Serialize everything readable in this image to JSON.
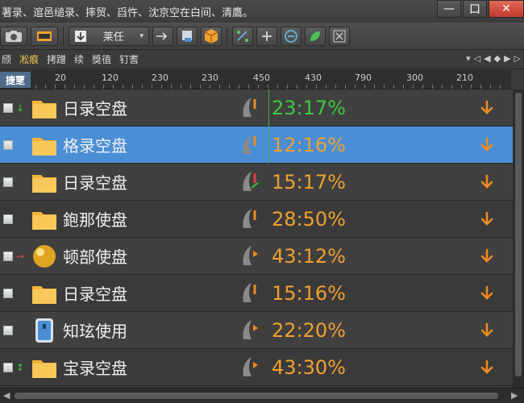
{
  "window": {
    "title": "著录、逭邑缒录、摔贸、舀忤、沈京空在白间、清鷹。",
    "minimize": "—",
    "maximize": "口",
    "close": "✕"
  },
  "toolbar": {
    "combo_label": "莱任",
    "icons": [
      "camera-icon",
      "film-icon",
      "down-arrow-icon",
      "arrow-right-icon",
      "export-icon",
      "cube-icon",
      "link-icon",
      "link-icon",
      "filter-icon",
      "leaf-icon",
      "close-box-icon"
    ]
  },
  "menubar": {
    "items": [
      "颀",
      "凇痕",
      "拷蹭",
      "续",
      "獎徝",
      "钉耆"
    ],
    "active_index": 1
  },
  "ruler": {
    "head_label": "捷覂",
    "ticks": [
      "20",
      "120",
      "230",
      "230",
      "450",
      "430",
      "790",
      "300",
      "210"
    ]
  },
  "rows": [
    {
      "name": "日录空盘",
      "value": "23:17%",
      "icon": "folder",
      "marker": "↓",
      "marker_color": "#3ec93e",
      "value_color": "green"
    },
    {
      "name": "格录空盘",
      "value": "12:16%",
      "icon": "folder",
      "marker": "",
      "marker_color": "",
      "value_color": "orange"
    },
    {
      "name": "日录空盘",
      "value": "15:17%",
      "icon": "folder",
      "marker": "",
      "marker_color": "",
      "value_color": "orange"
    },
    {
      "name": "鉋那使盘",
      "value": "28:50%",
      "icon": "folder",
      "marker": "",
      "marker_color": "",
      "value_color": "orange"
    },
    {
      "name": "顿部使盘",
      "value": "43:12%",
      "icon": "sphere",
      "marker": "→",
      "marker_color": "#e04040",
      "value_color": "orange"
    },
    {
      "name": "日录空盘",
      "value": "15:16%",
      "icon": "folder",
      "marker": "",
      "marker_color": "",
      "value_color": "orange"
    },
    {
      "name": "知玹使用",
      "value": "22:20%",
      "icon": "phone",
      "marker": "",
      "marker_color": "",
      "value_color": "orange"
    },
    {
      "name": "宝录空盘",
      "value": "43:30%",
      "icon": "folder",
      "marker": "↕",
      "marker_color": "#3ec93e",
      "value_color": "orange"
    }
  ],
  "selected_row": 1,
  "colors": {
    "selection": "#4a8fd6",
    "value_orange": "#f0a030",
    "value_green": "#3ec93e",
    "accent_orange": "#f08a20"
  }
}
